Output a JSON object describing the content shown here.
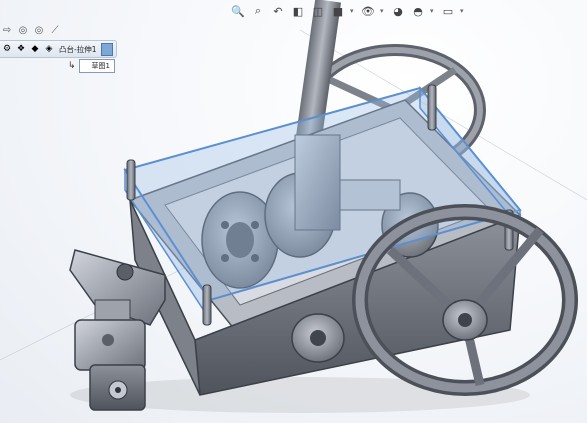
{
  "heads_up_toolbar": {
    "items": [
      {
        "name": "zoom-to-fit-icon",
        "glyph": "🔍"
      },
      {
        "name": "zoom-to-area-icon",
        "glyph": "⌕"
      },
      {
        "name": "previous-view-icon",
        "glyph": "↶"
      },
      {
        "name": "section-view-icon",
        "glyph": "◧"
      },
      {
        "name": "view-orientation-icon",
        "glyph": "◫"
      },
      {
        "name": "display-style-icon",
        "glyph": "■"
      },
      {
        "name": "hide-show-items-icon",
        "glyph": "👁"
      },
      {
        "name": "edit-appearance-icon",
        "glyph": "◕"
      },
      {
        "name": "apply-scene-icon",
        "glyph": "◓"
      },
      {
        "name": "view-settings-icon",
        "glyph": "▭"
      }
    ]
  },
  "feature_manager_tabs": {
    "items": [
      {
        "name": "pointer-icon",
        "glyph": "⇨"
      },
      {
        "name": "target-icon",
        "glyph": "◎"
      },
      {
        "name": "target-alt-icon",
        "glyph": "◎"
      },
      {
        "name": "smart-dimension-icon",
        "glyph": "⟋"
      }
    ]
  },
  "breadcrumb": {
    "feature_label": "凸台-拉伸1",
    "icons": [
      {
        "name": "gear-icon",
        "glyph": "⚙"
      },
      {
        "name": "assembly-icon",
        "glyph": "❖"
      },
      {
        "name": "part-icon",
        "glyph": "◆"
      },
      {
        "name": "component-icon",
        "glyph": "◈"
      }
    ]
  },
  "sketch_tag": {
    "label": "草图1"
  },
  "colors": {
    "metal": "#8e929c",
    "metal_dark": "#5e626c",
    "metal_light": "#c4c8d0",
    "selection_blue": "#5b8fd0",
    "selection_fill": "#9bbce6"
  }
}
